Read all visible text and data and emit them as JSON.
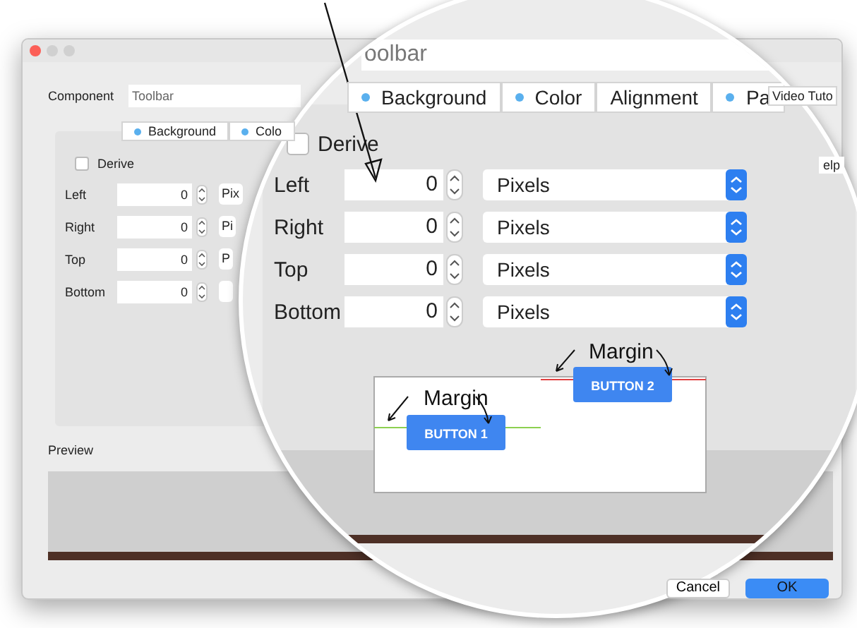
{
  "component": {
    "label": "Component",
    "value": "Toolbar"
  },
  "tabs": [
    {
      "label": "Background",
      "dot": true
    },
    {
      "label": "Colo",
      "dot": true
    }
  ],
  "derive": {
    "label": "Derive",
    "checked": false
  },
  "margins": [
    {
      "label": "Left",
      "value": "0",
      "unit": "Pix"
    },
    {
      "label": "Right",
      "value": "0",
      "unit": "Pi"
    },
    {
      "label": "Top",
      "value": "0",
      "unit": "P"
    },
    {
      "label": "Bottom",
      "value": "0"
    }
  ],
  "preview": {
    "label": "Preview"
  },
  "buttons": [
    {
      "label": "Cancel",
      "default": false
    },
    {
      "label": "OK",
      "default": true
    }
  ],
  "magnifier": {
    "component_value": "oolbar",
    "tabs": [
      {
        "label": "Background",
        "dot": true
      },
      {
        "label": "Color",
        "dot": true
      },
      {
        "label": "Alignment",
        "dot": false
      },
      {
        "label": "Pa",
        "dot": true
      }
    ],
    "side_tab": "Video Tuto",
    "derive": {
      "label": "Derive",
      "checked": false
    },
    "side_button": "elp",
    "margins": [
      {
        "label": "Left",
        "value": "0",
        "unit": "Pixels"
      },
      {
        "label": "Right",
        "value": "0",
        "unit": "Pixels"
      },
      {
        "label": "Top",
        "value": "0",
        "unit": "Pixels"
      },
      {
        "label": "Bottom",
        "value": "0",
        "unit": "Pixels"
      }
    ],
    "diagram": {
      "margin_labels": [
        "Margin",
        "Margin"
      ],
      "buttons": [
        "BUTTON 1",
        "BUTTON 2"
      ]
    }
  }
}
